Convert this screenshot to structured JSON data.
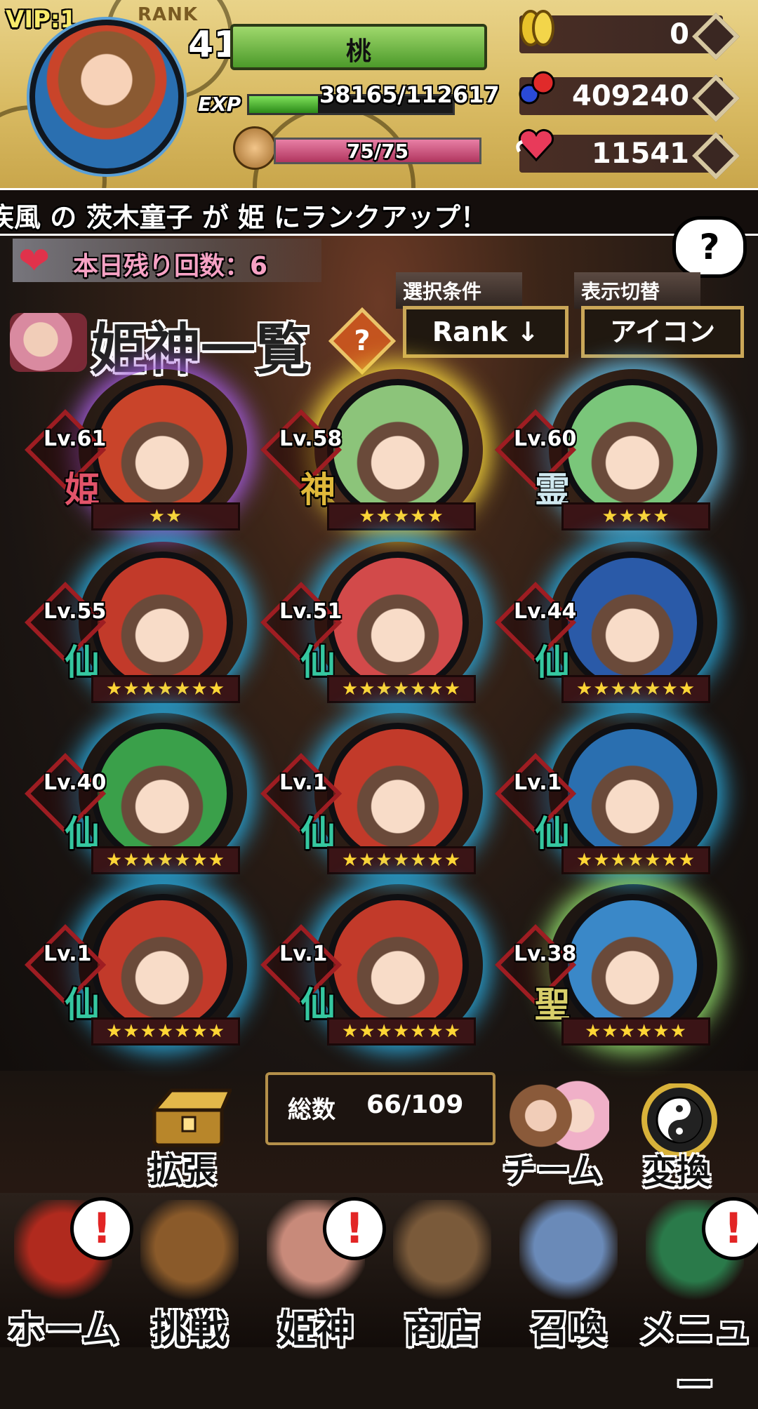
{
  "header": {
    "vip": "VIP:1",
    "rank_tag": "RANK",
    "rank": "41",
    "player_name": "桃",
    "exp_label": "EXP",
    "exp": "38165/112617",
    "exp_progress": 0.339,
    "stamina": "75/75",
    "stamina_progress": 1.0,
    "gold": "0",
    "orbs": "409240",
    "hearts": "11541"
  },
  "ticker": "疾風 の 茨木童子 が 姫 にランクアップ！",
  "daily": {
    "text": "本日残り回数：6"
  },
  "help": "?",
  "filters": {
    "select_label": "選択条件",
    "select_value": "Rank ↓",
    "display_label": "表示切替",
    "display_value": "アイコン"
  },
  "title": "姫神一覧",
  "title_help": "?",
  "characters": [
    {
      "level": "Lv.61",
      "class": "姫",
      "stars": "★★",
      "class_color": "#e2546a",
      "aura": "#a05bd8",
      "skin": "#c9442a"
    },
    {
      "level": "Lv.58",
      "class": "神",
      "stars": "★★★★★",
      "class_color": "#e0b93a",
      "aura": "#f0d23a",
      "skin": "#8cc47a"
    },
    {
      "level": "Lv.60",
      "class": "霊",
      "stars": "★★★★",
      "class_color": "#cfe8ef",
      "aura": "#5fb8e0",
      "skin": "#7ac67a"
    },
    {
      "level": "Lv.55",
      "class": "仙",
      "stars": "★★★★★★★",
      "class_color": "#35c7a0",
      "aura": "#2aa6d8",
      "skin": "#c23a2a"
    },
    {
      "level": "Lv.51",
      "class": "仙",
      "stars": "★★★★★★★",
      "class_color": "#35c7a0",
      "aura": "#2aa6d8",
      "skin": "#d24a4a"
    },
    {
      "level": "Lv.44",
      "class": "仙",
      "stars": "★★★★★★★",
      "class_color": "#35c7a0",
      "aura": "#2aa6d8",
      "skin": "#2a5aa8"
    },
    {
      "level": "Lv.40",
      "class": "仙",
      "stars": "★★★★★★★",
      "class_color": "#35c7a0",
      "aura": "#2aa6d8",
      "skin": "#3aa04a"
    },
    {
      "level": "Lv.1",
      "class": "仙",
      "stars": "★★★★★★★",
      "class_color": "#35c7a0",
      "aura": "#2aa6d8",
      "skin": "#c23a2a"
    },
    {
      "level": "Lv.1",
      "class": "仙",
      "stars": "★★★★★★★",
      "class_color": "#35c7a0",
      "aura": "#2aa6d8",
      "skin": "#2a6fb0"
    },
    {
      "level": "Lv.1",
      "class": "仙",
      "stars": "★★★★★★★",
      "class_color": "#35c7a0",
      "aura": "#2aa6d8",
      "skin": "#c23a2a"
    },
    {
      "level": "Lv.1",
      "class": "仙",
      "stars": "★★★★★★★",
      "class_color": "#35c7a0",
      "aura": "#2aa6d8",
      "skin": "#c23a2a"
    },
    {
      "level": "Lv.38",
      "class": "聖",
      "stars": "★★★★★★",
      "class_color": "#d8cf6a",
      "aura": "#8fd86a",
      "skin": "#3a88c8"
    }
  ],
  "total": {
    "label": "総数",
    "value": "66/109"
  },
  "actions": {
    "expand": "拡張",
    "team": "チーム",
    "convert": "変換"
  },
  "nav": [
    {
      "label": "ホーム",
      "alert": "!",
      "art": "#b02a1e"
    },
    {
      "label": "挑戦",
      "alert": "",
      "art": "#8a5a2a"
    },
    {
      "label": "姫神",
      "alert": "!",
      "art": "#c88a7a"
    },
    {
      "label": "商店",
      "alert": "",
      "art": "#7a5a3a"
    },
    {
      "label": "召喚",
      "alert": "",
      "art": "#6a8ab8"
    },
    {
      "label": "メニュー",
      "alert": "!",
      "art": "#2a7a4a"
    }
  ]
}
